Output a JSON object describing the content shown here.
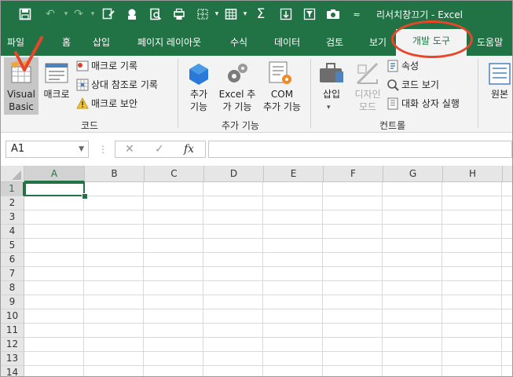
{
  "window": {
    "title": "리서치창끄기  -  Excel"
  },
  "tabs": [
    "파일",
    "홈",
    "삽입",
    "페이지 레이아웃",
    "수식",
    "데이터",
    "검토",
    "보기",
    "개발 도구",
    "도움말"
  ],
  "active_tab": "개발 도구",
  "ribbon": {
    "code": {
      "visual_basic": [
        "Visual",
        "Basic"
      ],
      "macros": "매크로",
      "record_macro": "매크로 기록",
      "relative_refs": "상대 참조로 기록",
      "macro_security": "매크로 보안",
      "label": "코드"
    },
    "addins": {
      "addins": [
        "추가",
        "기능"
      ],
      "excel_addins": [
        "Excel 추",
        "가 기능"
      ],
      "com_addins": [
        "COM",
        "추가 기능"
      ],
      "label": "추가 기능"
    },
    "controls": {
      "insert": "삽입",
      "design_mode": [
        "디자인",
        "모드"
      ],
      "properties": "속성",
      "view_code": "코드 보기",
      "run_dialog": "대화 상자 실행",
      "label": "컨트롤"
    },
    "xml": {
      "source": "원본"
    }
  },
  "formula_bar": {
    "name_box": "A1",
    "fx": "fx",
    "cancel": "✕",
    "enter": "✓",
    "value": ""
  },
  "sheet": {
    "columns": [
      "A",
      "B",
      "C",
      "D",
      "E",
      "F",
      "G",
      "H"
    ],
    "rows": [
      "1",
      "2",
      "3",
      "4",
      "5",
      "6",
      "7",
      "8",
      "9",
      "10",
      "11",
      "12",
      "13",
      "14"
    ],
    "selected_cell": "A1"
  },
  "colors": {
    "brand": "#217346",
    "annotation": "#e8462a"
  }
}
